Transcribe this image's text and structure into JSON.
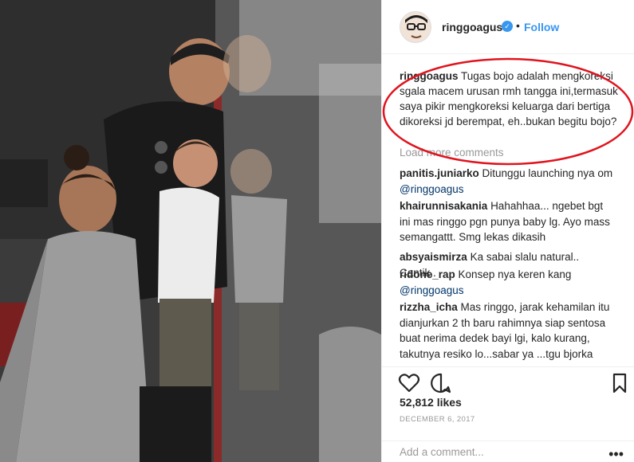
{
  "post": {
    "username": "ringgoagus",
    "follow_label": "Follow",
    "separator": "•",
    "caption": "Tugas bojo adalah mengkoreksi sgala macem urusan rmh tangga ini,termasuk saya pikir mengkoreksi keluarga dari bertiga dikoreksi jd berempat, eh..bukan begitu bojo?",
    "load_more": "Load more comments",
    "comments": [
      {
        "user": "panitis.juniarko",
        "text": "Ditunggu launching nya om ",
        "mention": "@ringgoagus"
      },
      {
        "user": "khairunnisakania",
        "text": "Hahahhaa... ngebet bgt ini mas ringgo pgn punya baby lg. Ayo mass semangattt. Smg lekas dikasih",
        "mention": ""
      },
      {
        "user": "absyaismirza",
        "text": "Ka sabai slalu natural.. Cantik..",
        "mention": ""
      },
      {
        "user": "ridone_rap",
        "text": "Konsep nya keren kang ",
        "mention": "@ringgoagus"
      },
      {
        "user": "rizzha_icha",
        "text": "Mas ringgo, jarak kehamilan itu dianjurkan 2 th baru rahimnya siap sentosa buat nerima dedek bayi lgi, kalo kurang, takutnya resiko lo...sabar ya ...tgu bjorka",
        "mention": ""
      }
    ],
    "likes": "52,812 likes",
    "date": "DECEMBER 6, 2017",
    "add_comment_placeholder": "Add a comment...",
    "more_label": "•••"
  },
  "icons": {
    "heart": "heart-icon",
    "comment": "comment-icon",
    "bookmark": "bookmark-icon",
    "verified": "verified-badge-icon"
  },
  "colors": {
    "accent": "#3897f0",
    "highlight_ellipse": "#e0141e",
    "text": "#262626",
    "muted": "#999999"
  }
}
